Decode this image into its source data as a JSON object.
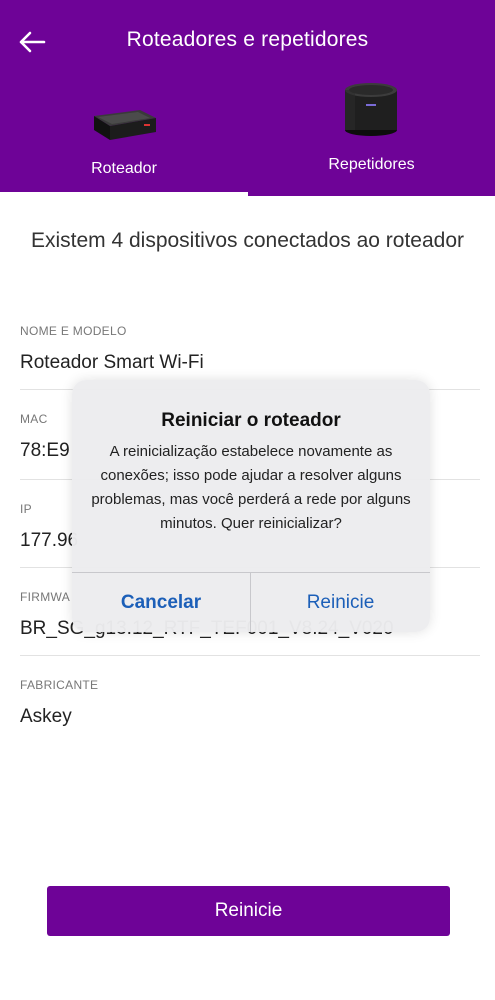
{
  "header": {
    "title": "Roteadores e repetidores",
    "back_icon": "arrow-left-icon",
    "background": "#6e0397"
  },
  "tabs": [
    {
      "label": "Roteador",
      "selected": true,
      "image": "router-device-image"
    },
    {
      "label": "Repetidores",
      "selected": false,
      "image": "repeater-device-image"
    }
  ],
  "subtitle": "Existem 4 dispositivos conectados ao roteador",
  "fields": [
    {
      "label": "NOME E MODELO",
      "value": "Roteador Smart Wi-Fi"
    },
    {
      "label": "MAC",
      "value": "78:E9"
    },
    {
      "label": "IP",
      "value": "177.96"
    },
    {
      "label": "FIRMWA",
      "value": "BR_SG_g13.12_RTF_TEF001_V8.24_V020"
    },
    {
      "label": "FABRICANTE",
      "value": "Askey"
    }
  ],
  "dialog": {
    "title": "Reiniciar o roteador",
    "message": "A reinicialização estabelece novamente as conexões; isso pode ajudar a resolver alguns problemas, mas você perderá a rede por alguns minutos. Quer reinicializar?",
    "cancel_label": "Cancelar",
    "confirm_label": "Reinicie",
    "button_color": "#1c5fb8"
  },
  "footer": {
    "restart_label": "Reinicie",
    "accent": "#6e0397"
  }
}
